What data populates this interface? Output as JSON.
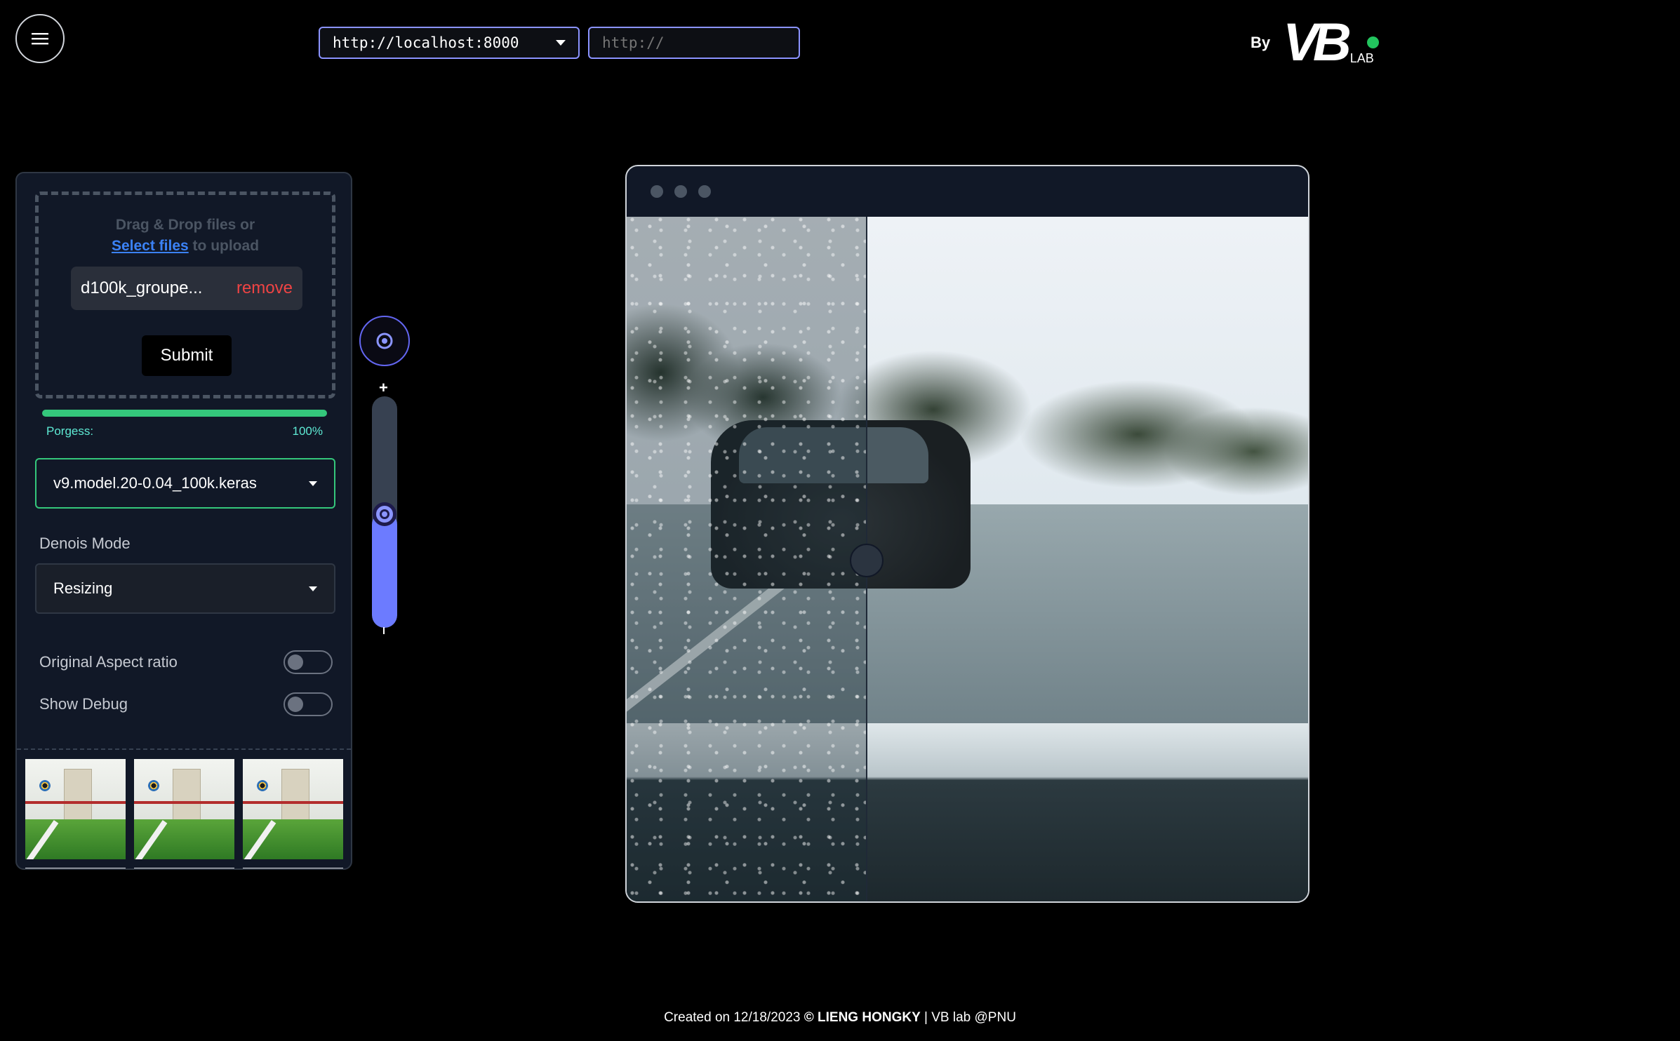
{
  "header": {
    "menu_icon": "hamburger-icon",
    "server_url": "http://localhost:8000",
    "custom_url_placeholder": "http://",
    "brand_by": "By",
    "brand_logo": "VB",
    "brand_sub": "LAB",
    "status_color": "#22c55e"
  },
  "sidebar": {
    "upload": {
      "prompt_line1": "Drag & Drop files or",
      "select_link": "Select files",
      "prompt_suffix": " to upload",
      "file_name": "d100k_groupe...",
      "remove_label": "remove",
      "submit_label": "Submit"
    },
    "progress": {
      "label": "Porgess:",
      "value_text": "100%",
      "value": 1.0,
      "color": "#34c77b"
    },
    "model_select": {
      "value": "v9.model.20-0.04_100k.keras"
    },
    "denoise": {
      "label": "Denois Mode",
      "value": "Resizing"
    },
    "toggles": [
      {
        "label": "Original Aspect ratio",
        "on": false
      },
      {
        "label": "Show Debug",
        "on": false
      }
    ],
    "gallery_count": 3
  },
  "zoom": {
    "focus_icon": "target-icon",
    "plus": "+",
    "level": 0.5,
    "accent": "#6c7bff"
  },
  "viewer": {
    "split_position": 0.35
  },
  "footer": {
    "prefix": "Created on 12/18/2023 ",
    "copyright": "© LIENG HONGKY",
    "suffix": " | VB lab @PNU"
  }
}
